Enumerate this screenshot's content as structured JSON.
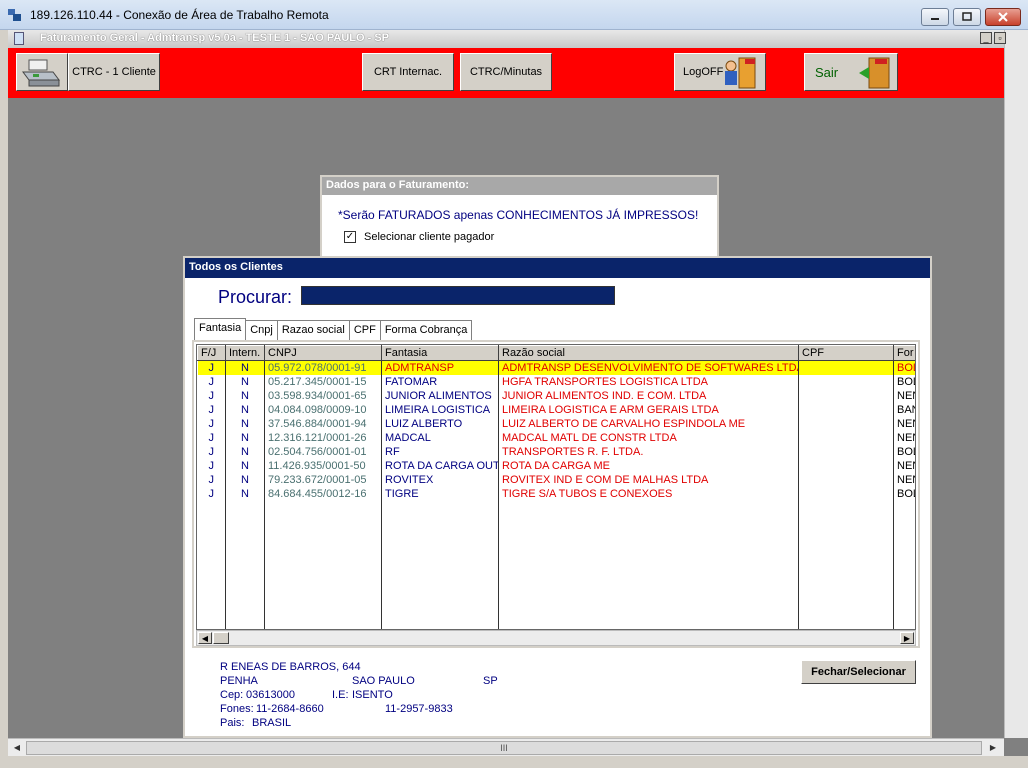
{
  "rdp": {
    "title": "189.126.110.44 - Conexão de Área de Trabalho Remota"
  },
  "app": {
    "title": "Faturamento Geral - Admtransp v5.0a - TESTE 1 - SAO PAULO - SP"
  },
  "toolbar": {
    "ctrc_cliente": "CTRC - 1 Cliente",
    "crt_internac": "CRT Internac.",
    "ctrc_minutas": "CTRC/Minutas",
    "logoff": "LogOFF",
    "sair": "Sair",
    "accent": "#ff0000"
  },
  "dados": {
    "header": "Dados para o Faturamento:",
    "note": "*Serão FATURADOS apenas CONHECIMENTOS JÁ IMPRESSOS!",
    "checkbox_label": "Selecionar cliente pagador",
    "checkbox_checked": true
  },
  "dialog": {
    "header": "Todos os Clientes",
    "search_label": "Procurar:",
    "search_value": "",
    "tabs": [
      "Fantasia",
      "Cnpj",
      "Razao social",
      "CPF",
      "Forma Cobrança"
    ],
    "active_tab": "Fantasia",
    "columns": [
      "F/J",
      "Intern.",
      "CNPJ",
      "Fantasia",
      "Razão social",
      "CPF",
      "For"
    ],
    "rows": [
      {
        "fj": "J",
        "intern": "N",
        "cnpj": "05.972.078/0001-91",
        "fantasia": "ADMTRANSP",
        "razao": "ADMTRANSP DESENVOLVIMENTO DE SOFTWARES LTDA",
        "cpf": "",
        "forma": "BOL"
      },
      {
        "fj": "J",
        "intern": "N",
        "cnpj": "05.217.345/0001-15",
        "fantasia": "FATOMAR",
        "razao": "HGFA TRANSPORTES LOGISTICA LTDA",
        "cpf": "",
        "forma": "BOL"
      },
      {
        "fj": "J",
        "intern": "N",
        "cnpj": "03.598.934/0001-65",
        "fantasia": "JUNIOR ALIMENTOS",
        "razao": "JUNIOR ALIMENTOS IND. E COM. LTDA",
        "cpf": "",
        "forma": "NEN"
      },
      {
        "fj": "J",
        "intern": "N",
        "cnpj": "04.084.098/0009-10",
        "fantasia": "LIMEIRA LOGISTICA",
        "razao": "LIMEIRA LOGISTICA E ARM GERAIS LTDA",
        "cpf": "",
        "forma": "BAN"
      },
      {
        "fj": "J",
        "intern": "N",
        "cnpj": "37.546.884/0001-94",
        "fantasia": "LUIZ ALBERTO",
        "razao": "LUIZ ALBERTO DE CARVALHO ESPINDOLA ME",
        "cpf": "",
        "forma": "NEN"
      },
      {
        "fj": "J",
        "intern": "N",
        "cnpj": "12.316.121/0001-26",
        "fantasia": "MADCAL",
        "razao": "MADCAL MATL DE CONSTR LTDA",
        "cpf": "",
        "forma": "NEN"
      },
      {
        "fj": "J",
        "intern": "N",
        "cnpj": "02.504.756/0001-01",
        "fantasia": "RF",
        "razao": "TRANSPORTES R. F. LTDA.",
        "cpf": "",
        "forma": "BOL"
      },
      {
        "fj": "J",
        "intern": "N",
        "cnpj": "11.426.935/0001-50",
        "fantasia": "ROTA DA CARGA OUTS",
        "razao": "ROTA DA CARGA ME",
        "cpf": "",
        "forma": "NEN"
      },
      {
        "fj": "J",
        "intern": "N",
        "cnpj": "79.233.672/0001-05",
        "fantasia": "ROVITEX",
        "razao": "ROVITEX IND E COM DE MALHAS LTDA",
        "cpf": "",
        "forma": "NEN"
      },
      {
        "fj": "J",
        "intern": "N",
        "cnpj": "84.684.455/0012-16",
        "fantasia": "TIGRE",
        "razao": "TIGRE S/A TUBOS E CONEXOES",
        "cpf": "",
        "forma": "BOL"
      }
    ],
    "selected_row": 0,
    "address": {
      "street": "R ENEAS DE BARROS, 644",
      "bairro": "PENHA",
      "cidade": "SAO PAULO",
      "uf": "SP",
      "cep_label": "Cep:",
      "cep": "03613000",
      "ie_label": "I.E:",
      "ie": "ISENTO",
      "fones_label": "Fones:",
      "fone1": "11-2684-8660",
      "fone2": "11-2957-9833",
      "pais_label": "Pais:",
      "pais": "BRASIL"
    },
    "close_button": "Fechar/Selecionar"
  }
}
